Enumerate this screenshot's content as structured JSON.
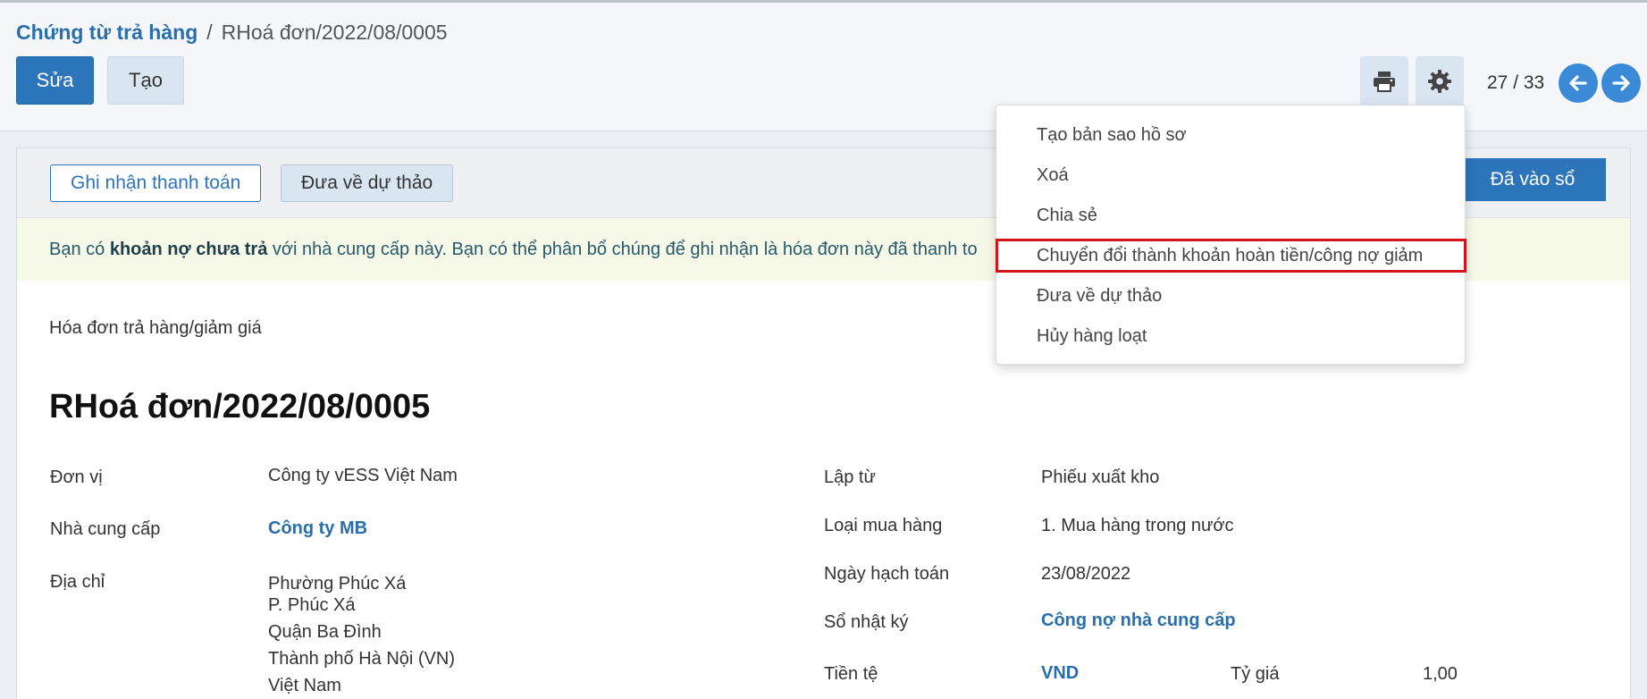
{
  "breadcrumb": {
    "parent": "Chứng từ trả hàng",
    "separator": "/",
    "current": "RHoá đơn/2022/08/0005"
  },
  "toolbar": {
    "edit_label": "Sửa",
    "create_label": "Tạo"
  },
  "pager": {
    "text": "27 / 33"
  },
  "statusbar": {
    "register_payment_label": "Ghi nhận thanh toán",
    "reset_draft_label": "Đưa về dự thảo",
    "status_label": "Đã vào sổ"
  },
  "alert": {
    "prefix": "Bạn có",
    "bold": "khoản nợ chưa trả",
    "suffix": "với nhà cung cấp này. Bạn có thể phân bổ chúng để ghi nhận là hóa đơn này đã thanh to"
  },
  "document": {
    "type": "Hóa đơn trả hàng/giảm giá",
    "title": "RHoá đơn/2022/08/0005"
  },
  "fields_left": {
    "company_label": "Đơn vị",
    "company_value": "Công ty vESS Việt Nam",
    "vendor_label": "Nhà cung cấp",
    "vendor_value": "Công ty MB",
    "address_label": "Địa chỉ",
    "address_lines": [
      "Phường Phúc Xá",
      "P. Phúc Xá",
      "Quận Ba Đình",
      "Thành phố Hà Nội (VN)",
      "Việt Nam"
    ]
  },
  "fields_right": {
    "created_from_label": "Lập từ",
    "created_from_value": "Phiếu xuất kho",
    "purchase_type_label": "Loại mua hàng",
    "purchase_type_value": "1. Mua hàng trong nước",
    "accounting_date_label": "Ngày hạch toán",
    "accounting_date_value": "23/08/2022",
    "journal_label": "Sổ nhật ký",
    "journal_value": "Công nợ nhà cung cấp",
    "currency_label": "Tiền tệ",
    "currency_value": "VND",
    "rate_label": "Tỷ giá",
    "rate_value": "1,00"
  },
  "action_menu": {
    "items": [
      "Tạo bản sao hồ sơ",
      "Xoá",
      "Chia sẻ",
      "Chuyển đổi thành khoản hoàn tiền/công nợ giảm",
      "Đưa về dự thảo",
      "Hủy hàng loạt"
    ],
    "highlighted_index": 3
  },
  "colors": {
    "primary": "#2d75ba",
    "highlight_border": "#d4141b",
    "alert_bg": "#f7f9e8"
  },
  "icons": {
    "print": "printer-icon",
    "settings": "gear-icon",
    "prev": "arrow-left-icon",
    "next": "arrow-right-icon"
  }
}
